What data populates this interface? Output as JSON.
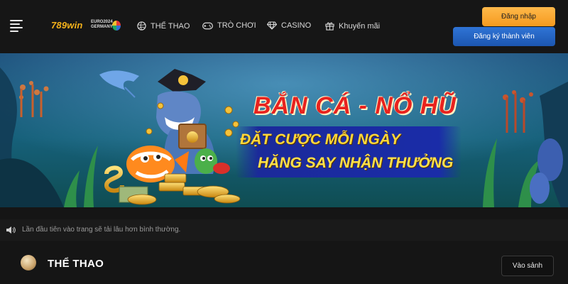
{
  "header": {
    "logo_text": "789win",
    "logo_badge": "EURO2024 GERMANY",
    "nav": [
      {
        "label": "THỂ THAO",
        "icon": "volleyball-icon"
      },
      {
        "label": "TRÒ CHƠI",
        "icon": "gamepad-icon"
      },
      {
        "label": "CASINO",
        "icon": "diamond-icon"
      },
      {
        "label": "Khuyến mãi",
        "icon": "gift-icon"
      }
    ],
    "login_label": "Đăng nhập",
    "register_label": "Đăng ký thành viên"
  },
  "banner": {
    "line1": "BẮN CÁ - NỔ HŨ",
    "line2": "ĐẶT CƯỢC MỖI NGÀY",
    "line3": "HĂNG SAY NHẬN THƯỞNG"
  },
  "notice": {
    "text": "Lần đầu tiên vào trang sẽ tải lâu hơn bình thường."
  },
  "section": {
    "title": "THỂ THAO",
    "lobby_label": "Vào sảnh"
  },
  "colors": {
    "login_button": "#f7a531",
    "register_button": "#2563c4",
    "logo_gold": "#f5b21b",
    "banner_headline": "#e8231e"
  }
}
